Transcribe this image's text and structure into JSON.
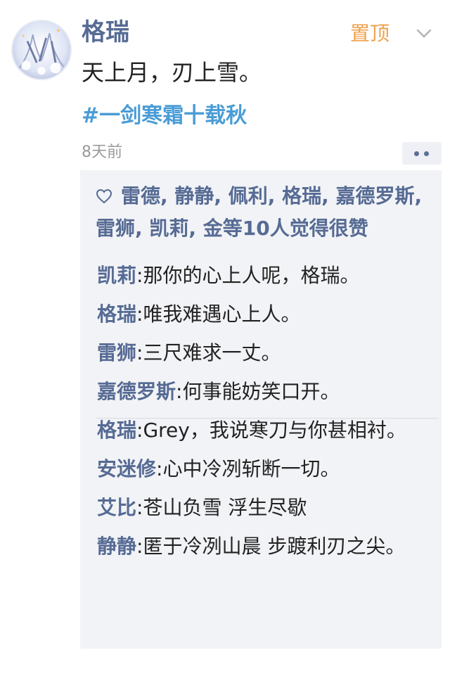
{
  "post": {
    "username": "格瑞",
    "pin_label": "置顶",
    "text": "天上月，刃上雪。",
    "topic": "#一剑寒霜十载秋",
    "time": "8天前"
  },
  "likes": {
    "text": "雷德, 静静, 佩利, 格瑞, 嘉德罗斯, 雷狮, 凯莉, 金等10人觉得很赞"
  },
  "comments": [
    {
      "author": "凯莉",
      "text": ":那你的心上人呢，格瑞。"
    },
    {
      "author": "格瑞",
      "text": ":唯我难遇心上人。"
    },
    {
      "author": "雷狮",
      "text": ":三尺难求一丈。"
    },
    {
      "author": "嘉德罗斯",
      "text": ":何事能妨笑口开。"
    },
    {
      "author": "格瑞",
      "text": ":Grey，我说寒刀与你甚相衬。"
    },
    {
      "author": "安迷修",
      "text": ":心中冷冽斩断一切。"
    },
    {
      "author": "艾比",
      "text": ":苍山负雪 浮生尽歇"
    },
    {
      "author": "静静",
      "text": ":匿于冷冽山晨   步踱利刃之尖。"
    }
  ],
  "colors": {
    "name_blue": "#566b94",
    "topic_blue": "#4a9cd6",
    "pin_orange": "#f0a04b",
    "comment_bg": "#f2f3f6"
  },
  "icons": {
    "avatar": "avatar",
    "chevron": "chevron-down-icon",
    "more": "more-dots-icon",
    "heart": "heart-icon"
  }
}
